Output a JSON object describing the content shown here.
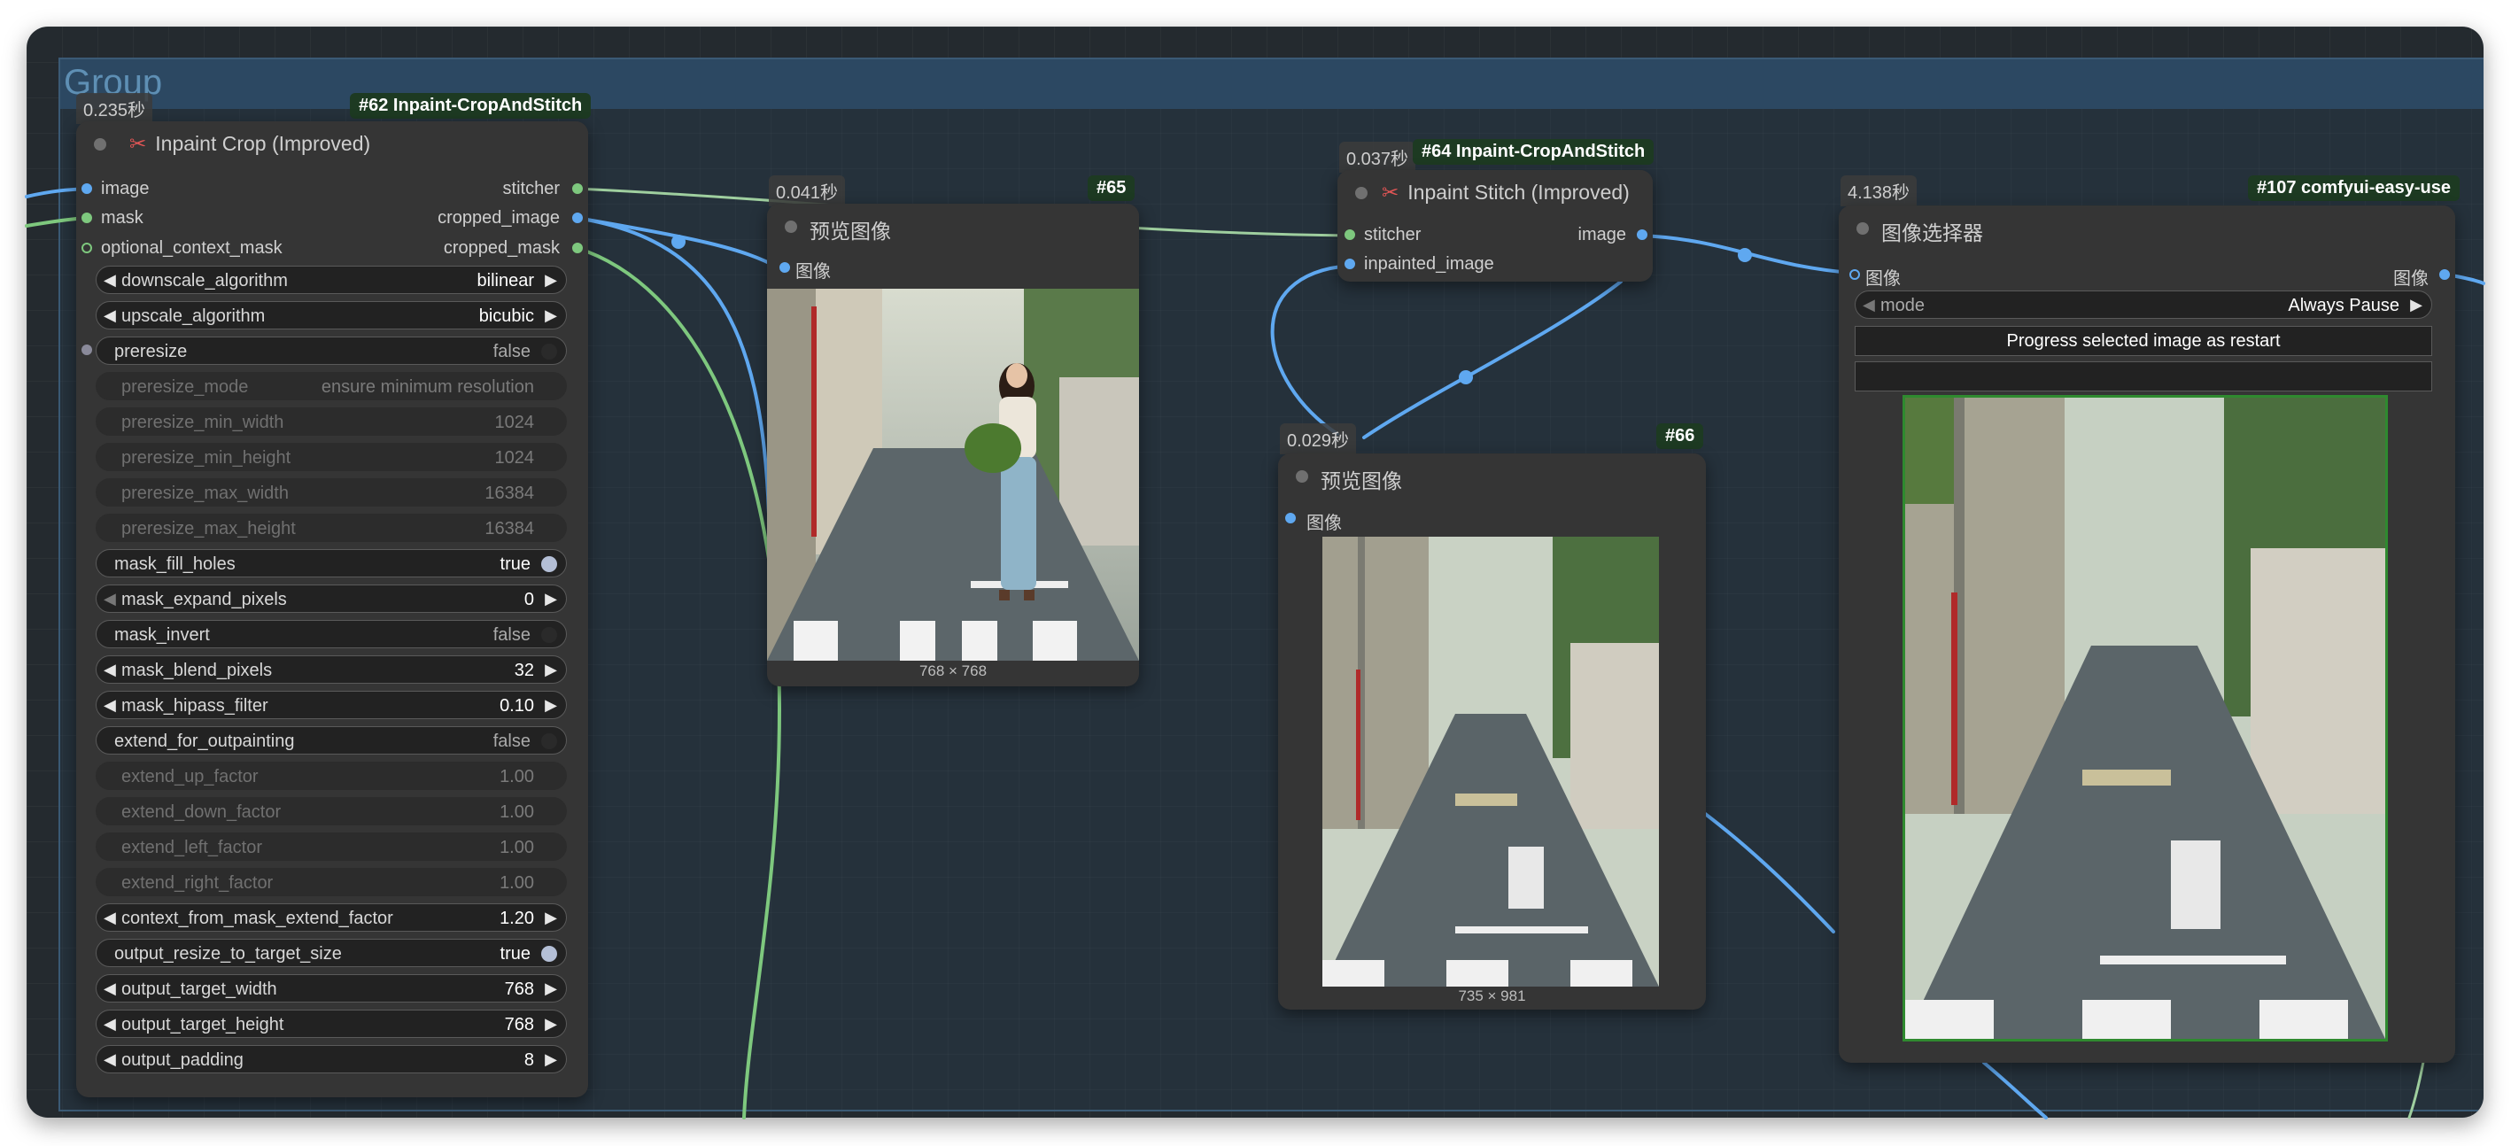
{
  "group": {
    "title": "Group"
  },
  "node62": {
    "timing": "0.235秒",
    "badge": "#62 Inpaint-CropAndStitch",
    "title": "Inpaint Crop (Improved)",
    "inputs": [
      "image",
      "mask",
      "optional_context_mask"
    ],
    "outputs": [
      "stitcher",
      "cropped_image",
      "cropped_mask"
    ],
    "widgets": [
      {
        "label": "downscale_algorithm",
        "value": "bilinear"
      },
      {
        "label": "upscale_algorithm",
        "value": "bicubic"
      },
      {
        "label": "preresize",
        "value": "false"
      },
      {
        "label": "preresize_mode",
        "value": "ensure minimum resolution"
      },
      {
        "label": "preresize_min_width",
        "value": "1024"
      },
      {
        "label": "preresize_min_height",
        "value": "1024"
      },
      {
        "label": "preresize_max_width",
        "value": "16384"
      },
      {
        "label": "preresize_max_height",
        "value": "16384"
      },
      {
        "label": "mask_fill_holes",
        "value": "true"
      },
      {
        "label": "mask_expand_pixels",
        "value": "0"
      },
      {
        "label": "mask_invert",
        "value": "false"
      },
      {
        "label": "mask_blend_pixels",
        "value": "32"
      },
      {
        "label": "mask_hipass_filter",
        "value": "0.10"
      },
      {
        "label": "extend_for_outpainting",
        "value": "false"
      },
      {
        "label": "extend_up_factor",
        "value": "1.00"
      },
      {
        "label": "extend_down_factor",
        "value": "1.00"
      },
      {
        "label": "extend_left_factor",
        "value": "1.00"
      },
      {
        "label": "extend_right_factor",
        "value": "1.00"
      },
      {
        "label": "context_from_mask_extend_factor",
        "value": "1.20"
      },
      {
        "label": "output_resize_to_target_size",
        "value": "true"
      },
      {
        "label": "output_target_width",
        "value": "768"
      },
      {
        "label": "output_target_height",
        "value": "768"
      },
      {
        "label": "output_padding",
        "value": "8"
      }
    ]
  },
  "node65": {
    "timing": "0.041秒",
    "badge": "#65",
    "title": "预览图像",
    "input": "图像",
    "dims": "768 × 768"
  },
  "node64": {
    "timing": "0.037秒",
    "badge": "#64 Inpaint-CropAndStitch",
    "title": "Inpaint Stitch (Improved)",
    "inputs": [
      "stitcher",
      "inpainted_image"
    ],
    "output": "image"
  },
  "node66": {
    "timing": "0.029秒",
    "badge": "#66",
    "title": "预览图像",
    "input": "图像",
    "dims": "735 × 981"
  },
  "node107": {
    "timing": "4.138秒",
    "badge": "#107 comfyui-easy-use",
    "title": "图像选择器",
    "input": "图像",
    "output": "图像",
    "mode_label": "mode",
    "mode_value": "Always Pause",
    "button_label": "Progress selected image as restart",
    "button2_label": ""
  },
  "colors": {
    "canvas": "#242a2f",
    "group_bg": "#2c4862",
    "image_link": "#5fa8f0",
    "mask_link": "#7ec87e",
    "node_bg": "#353535",
    "badge_bg": "#1d3a22"
  }
}
